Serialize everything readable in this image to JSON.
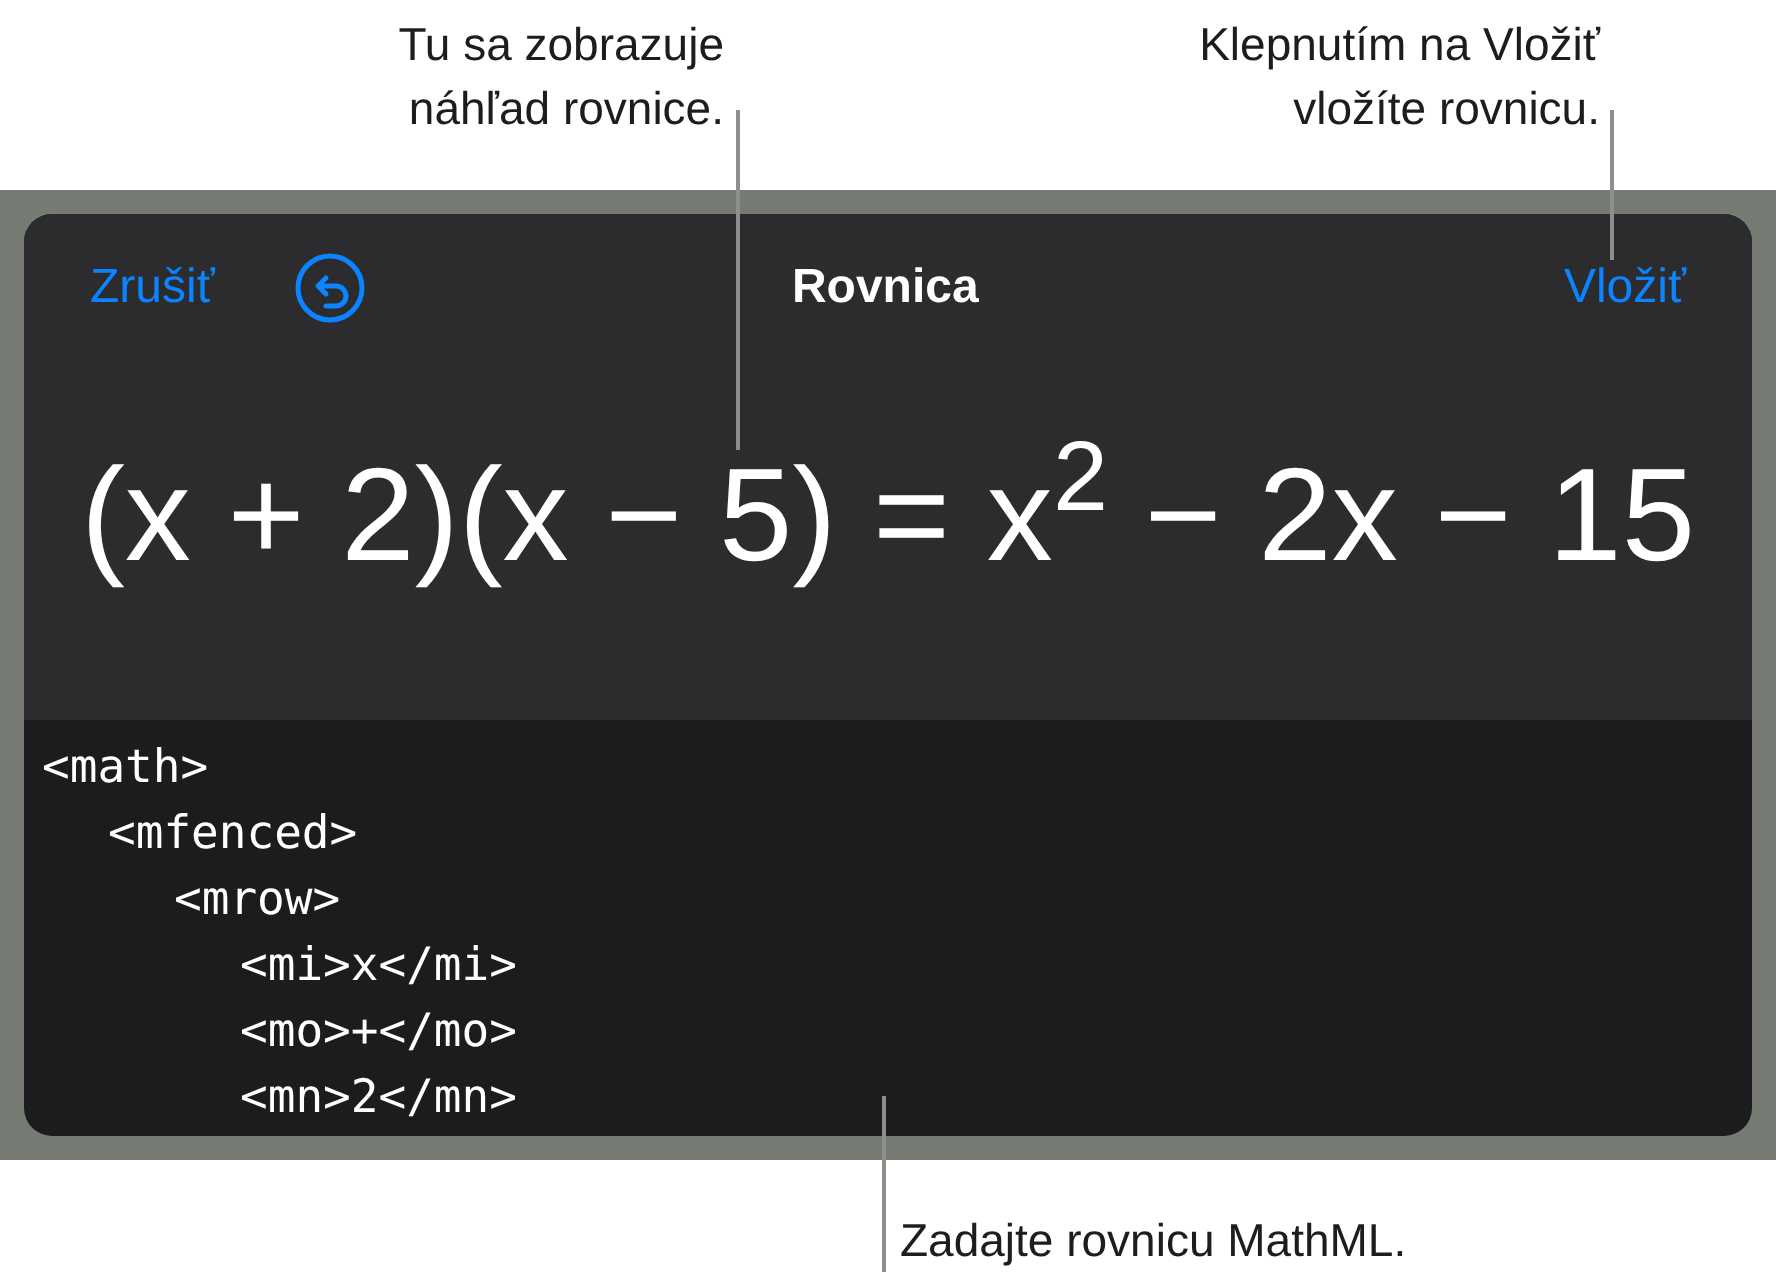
{
  "callouts": [
    {
      "text": "Tu sa zobrazuje\nnáhľad rovnice."
    },
    {
      "text": "Klepnutím na Vložiť\nvložíte rovnicu."
    },
    {
      "text": "Zadajte rovnicu MathML."
    }
  ],
  "dialog": {
    "cancel": "Zrušiť",
    "title": "Rovnica",
    "insert": "Vložiť",
    "equation": "(x + 2)(x − 5) = x$^{2}$ − 2x − 15",
    "code": [
      {
        "line": "<math>",
        "children": [
          {
            "line": "<mfenced>",
            "children": [
              {
                "line": "<mrow>",
                "children": [
                  {
                    "line": "<mi>x</mi>"
                  },
                  {
                    "line": "<mo>+</mo>"
                  },
                  {
                    "line": "<mn>2</mn>"
                  }
                ]
              }
            ]
          }
        ]
      }
    ]
  }
}
